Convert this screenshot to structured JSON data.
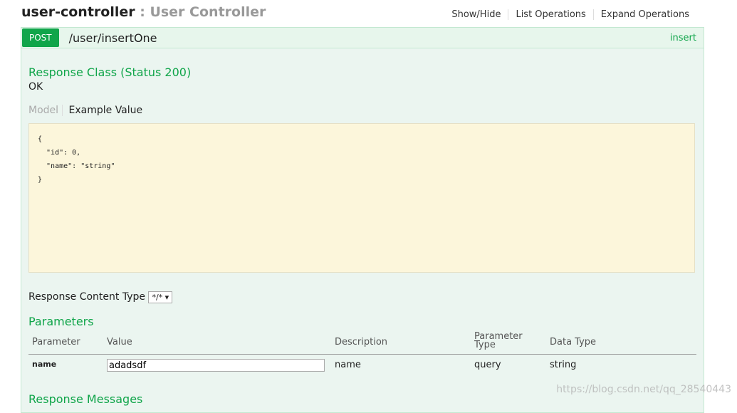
{
  "header": {
    "name": "user-controller",
    "separator": " : ",
    "description": "User Controller"
  },
  "links": [
    "Show/Hide",
    "List Operations",
    "Expand Operations"
  ],
  "operation": {
    "method": "POST",
    "path": "/user/insertOne",
    "summary": "insert"
  },
  "response_class": {
    "title": "Response Class (Status 200)",
    "text": "OK"
  },
  "tabs": {
    "model": "Model",
    "example": "Example Value"
  },
  "example": "{\n  \"id\": 0,\n  \"name\": \"string\"\n}",
  "content_type": {
    "label": "Response Content Type",
    "value": "*/* ▾"
  },
  "parameters": {
    "title": "Parameters",
    "headers": [
      "Parameter",
      "Value",
      "Description",
      "Parameter Type",
      "Data Type"
    ],
    "rows": [
      {
        "name": "name",
        "value": "adadsdf",
        "description": "name",
        "type": "query",
        "data_type": "string"
      }
    ]
  },
  "response_messages": "Response Messages",
  "watermark": "https://blog.csdn.net/qq_28540443"
}
